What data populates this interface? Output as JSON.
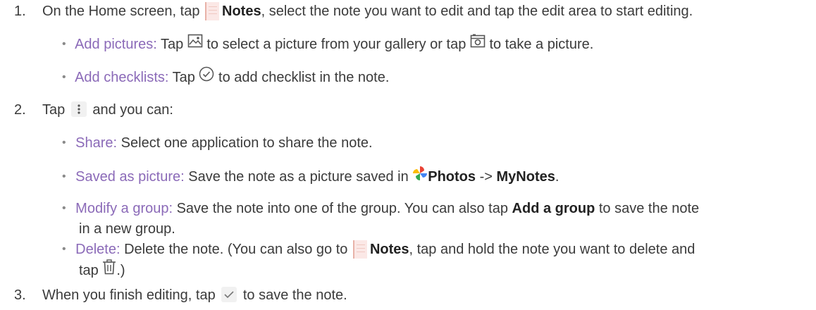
{
  "steps": [
    {
      "num": "1.",
      "pre": "On the Home screen, tap",
      "bold": "Notes",
      "post": ", select the note you want to edit and tap the edit area to start editing.",
      "items": [
        {
          "term": "Add pictures:",
          "a": "Tap",
          "b": "to select a picture from your gallery or tap",
          "c": "to take a picture."
        },
        {
          "term": "Add checklists:",
          "a": "Tap",
          "b": "to add checklist in the note."
        }
      ]
    },
    {
      "num": "2.",
      "pre": "Tap",
      "post": "and you can:",
      "items": [
        {
          "term": "Share:",
          "a": "Select one application to share the note."
        },
        {
          "term": "Saved as picture:",
          "a": "Save the note as a picture saved in",
          "bold1": "Photos",
          "arrow": "->",
          "bold2": "MyNotes",
          "end": "."
        },
        {
          "term": "Modify a group:",
          "a": "Save the note into one of the group. You can also tap",
          "bold1": "Add a group",
          "b": "to save the note",
          "c": "in a new group."
        },
        {
          "term": "Delete:",
          "a": "Delete the note. (You can also go to",
          "bold1": "Notes",
          "b": ", tap and hold the note you want to delete and",
          "c": "tap",
          "d": ".)"
        }
      ]
    },
    {
      "num": "3.",
      "pre": "When you finish editing, tap",
      "post": "to save the note."
    }
  ],
  "icons": {
    "notes": "notes-app-icon",
    "gallery": "gallery-icon",
    "camera": "camera-icon",
    "checklist": "checklist-icon",
    "more": "more-vertical-icon",
    "photos": "photos-app-icon",
    "delete": "trash-icon",
    "save": "checkmark-icon"
  }
}
